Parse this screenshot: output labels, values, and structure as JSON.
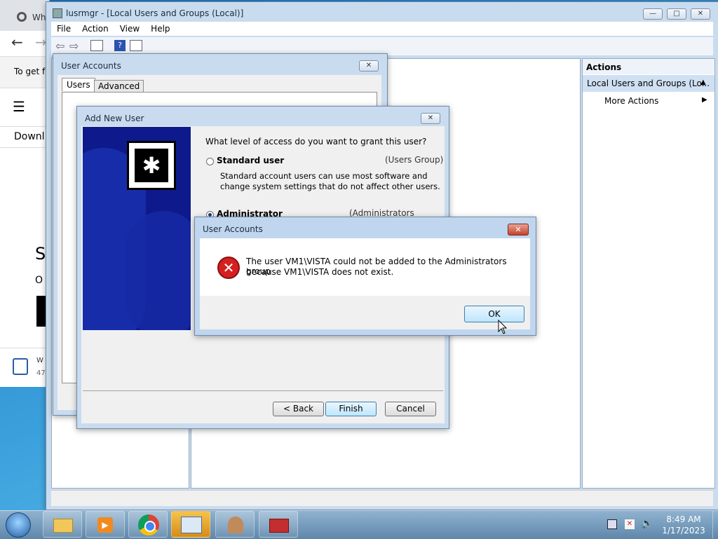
{
  "browser": {
    "tab_title": "Wh",
    "text_to_get": "To get f",
    "text_download": "Downl",
    "text_s": "S",
    "text_or": "O",
    "footer_title": "W",
    "footer_sub": "47"
  },
  "mmc": {
    "title": "lusrmgr - [Local Users and Groups (Local)]",
    "menu": [
      "File",
      "Action",
      "View",
      "Help"
    ],
    "actions_header": "Actions",
    "actions_selected": "Local Users and Groups (Lo...",
    "more_actions": "More Actions"
  },
  "user_accounts": {
    "title": "User Accounts",
    "tabs": [
      "Users",
      "Advanced"
    ]
  },
  "add_user": {
    "title": "Add New User",
    "question": "What level of access do you want to grant this user?",
    "standard_label": "Standard user",
    "standard_group": "(Users Group)",
    "standard_desc_1": "Standard account users can use most software and",
    "standard_desc_2": "change system settings that do not affect other users.",
    "admin_label": "Administrator",
    "admin_group": "(Administrators Group)",
    "back": "< Back",
    "finish": "Finish",
    "cancel": "Cancel",
    "selected": "Administrator"
  },
  "error_dialog": {
    "title": "User Accounts",
    "message_1": "The user VM1\\VISTA could not be added to the Administrators group",
    "message_2": "because VM1\\VISTA does not exist.",
    "ok": "OK"
  },
  "taskbar": {
    "time": "8:49 AM",
    "date": "1/17/2023",
    "apps": [
      "file-explorer",
      "media-player",
      "chrome",
      "control-panel",
      "user-accounts",
      "toolbox"
    ],
    "active_app": "control-panel"
  },
  "colors": {
    "error_red": "#d42020",
    "banner_blue": "#0e1a8c",
    "accent_blue": "#3399ff"
  }
}
